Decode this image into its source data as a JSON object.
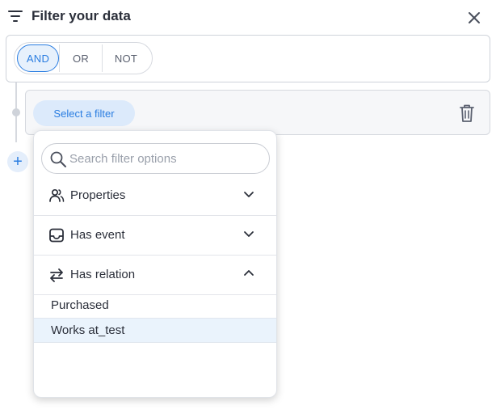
{
  "header": {
    "title": "Filter your data",
    "filter_icon": "filter-lines-icon",
    "close_icon": "close-icon"
  },
  "logic": {
    "options": [
      "AND",
      "OR",
      "NOT"
    ],
    "selected": "AND"
  },
  "filter_row": {
    "select_label": "Select a filter",
    "delete_icon": "trash-icon"
  },
  "add_button": {
    "label": "+"
  },
  "dropdown": {
    "search": {
      "placeholder": "Search filter options",
      "value": ""
    },
    "sections": [
      {
        "label": "Properties",
        "icon": "users-icon",
        "expanded": false
      },
      {
        "label": "Has event",
        "icon": "inbox-icon",
        "expanded": false
      },
      {
        "label": "Has relation",
        "icon": "swap-arrows-icon",
        "expanded": true
      }
    ],
    "relation_options": [
      {
        "label": "Purchased",
        "highlighted": false
      },
      {
        "label": "Works at_test",
        "highlighted": true
      }
    ]
  },
  "colors": {
    "accent": "#2a7de1",
    "accent_bg": "#dceafb",
    "border": "#d6d9df",
    "text": "#2b2f3a"
  }
}
